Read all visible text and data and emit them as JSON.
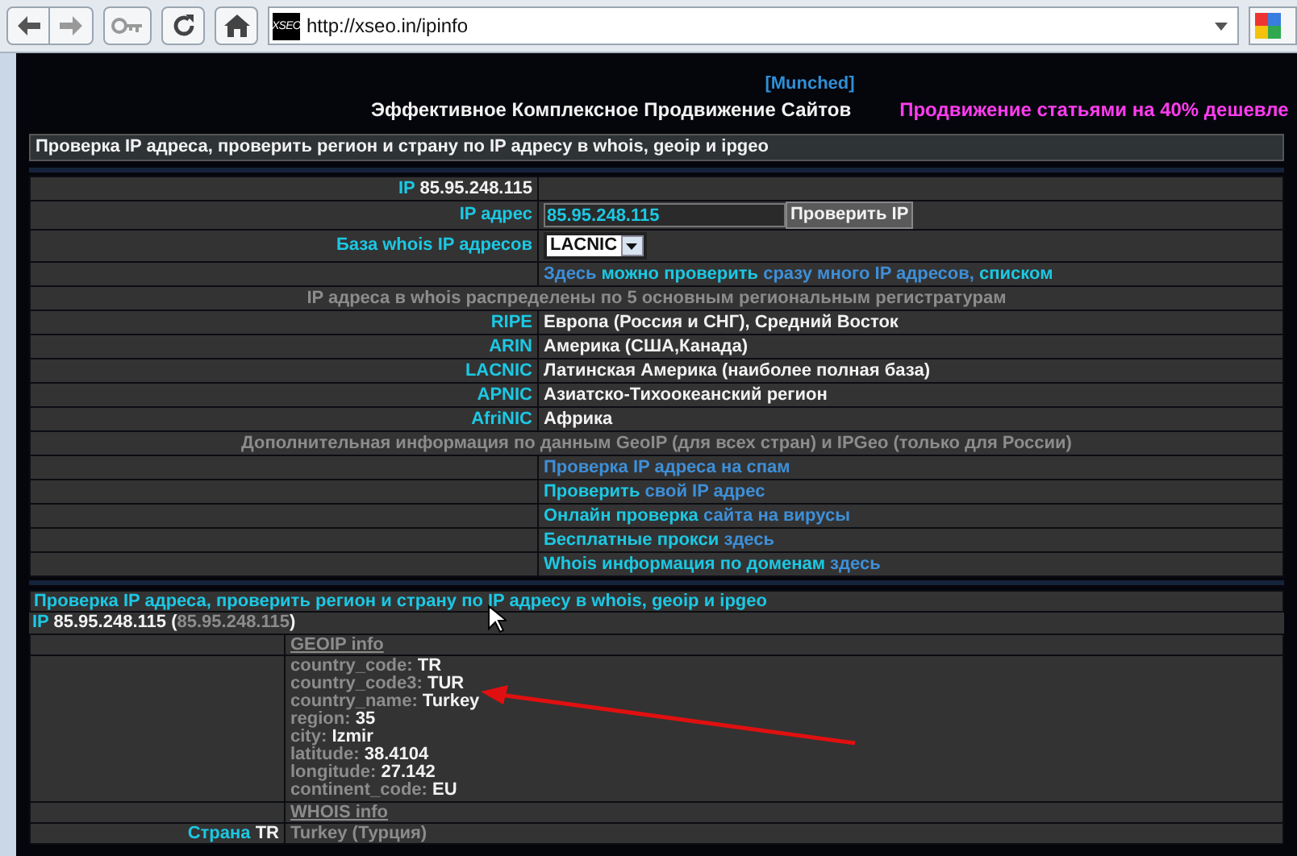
{
  "browser": {
    "url": "http://xseo.in/ipinfo",
    "site_badge": "XSEO"
  },
  "munched": "[Munched]",
  "headline": "Эффективное Комплексное Продвижение Сайтов",
  "promo": "Продвижение статьями на 40% дешевле",
  "section1": {
    "title": "Проверка IP адреса, проверить регион и страну по IP адресу в whois, geoip и ipgeo",
    "rows": [
      {
        "kind": "pair",
        "label": [
          {
            "text": "IP",
            "kind": "accent"
          },
          {
            "text": "85.95.248.115",
            "kind": "plain"
          }
        ],
        "value": []
      },
      {
        "kind": "input",
        "label": [
          {
            "text": "IP адрес",
            "kind": "accent"
          }
        ],
        "value_text": "85.95.248.115",
        "button": "Проверить IP"
      },
      {
        "kind": "select",
        "label": [
          {
            "text": "База whois IP адресов",
            "kind": "accent"
          }
        ],
        "selected_option": "LACNIC"
      },
      {
        "kind": "pair",
        "label": [],
        "value": [
          {
            "text": "Здесь",
            "kind": "link"
          },
          {
            "text": "можно проверить",
            "kind": "accent"
          },
          {
            "text": "сразу много IP адресов,",
            "kind": "link"
          },
          {
            "text": "списком",
            "kind": "accent"
          }
        ]
      },
      {
        "kind": "note",
        "text": "IP адреса в whois распределены по 5 основным региональным регистратурам"
      },
      {
        "kind": "pair",
        "label": [
          {
            "text": "RIPE",
            "kind": "accent"
          }
        ],
        "value": [
          {
            "text": "Европа (Россия и СНГ), Средний Восток",
            "kind": "plain"
          }
        ]
      },
      {
        "kind": "pair",
        "label": [
          {
            "text": "ARIN",
            "kind": "accent"
          }
        ],
        "value": [
          {
            "text": "Америка (США,Канада)",
            "kind": "plain"
          }
        ]
      },
      {
        "kind": "pair",
        "label": [
          {
            "text": "LACNIC",
            "kind": "accent"
          }
        ],
        "value": [
          {
            "text": "Латинская Америка (наиболее полная база)",
            "kind": "plain"
          }
        ]
      },
      {
        "kind": "pair",
        "label": [
          {
            "text": "APNIC",
            "kind": "accent"
          }
        ],
        "value": [
          {
            "text": "Азиатско-Тихоокеанский регион",
            "kind": "plain"
          }
        ]
      },
      {
        "kind": "pair",
        "label": [
          {
            "text": "AfriNIC",
            "kind": "accent"
          }
        ],
        "value": [
          {
            "text": "Африка",
            "kind": "plain"
          }
        ]
      },
      {
        "kind": "note",
        "text": "Дополнительная информация по данным GeoIP (для всех стран) и IPGeo (только для России)"
      },
      {
        "kind": "pair",
        "label": [],
        "value": [
          {
            "text": "Проверка IP адреса на спам",
            "kind": "link"
          }
        ]
      },
      {
        "kind": "pair",
        "label": [],
        "value": [
          {
            "text": "Проверить",
            "kind": "accent"
          },
          {
            "text": "свой IP адрес",
            "kind": "link"
          }
        ]
      },
      {
        "kind": "pair",
        "label": [],
        "value": [
          {
            "text": "Онлайн проверка",
            "kind": "accent"
          },
          {
            "text": "сайта на вирусы",
            "kind": "link"
          }
        ]
      },
      {
        "kind": "pair",
        "label": [],
        "value": [
          {
            "text": "Бесплатные прокси",
            "kind": "accent"
          },
          {
            "text": "здесь",
            "kind": "link"
          }
        ]
      },
      {
        "kind": "pair",
        "label": [],
        "value": [
          {
            "text": "Whois информация по доменам",
            "kind": "accent"
          },
          {
            "text": "здесь",
            "kind": "link"
          }
        ]
      }
    ]
  },
  "section2": {
    "title": "Проверка IP адреса, проверить регион и страну по IP адресу в whois, geoip и ipgeo",
    "ip_line": [
      {
        "text": "IP",
        "kind": "accent",
        "attached": false
      },
      {
        "text": "85.95.248.115",
        "kind": "plain",
        "attached": false
      },
      {
        "text": "(",
        "kind": "plain",
        "attached": false
      },
      {
        "text": "85.95.248.115",
        "kind": "muted",
        "attached": true
      },
      {
        "text": ")",
        "kind": "plain",
        "attached": true
      }
    ],
    "geoip_heading": "GEOIP info",
    "geoip": [
      {
        "key": "country_code:",
        "value": "TR"
      },
      {
        "key": "country_code3:",
        "value": "TUR"
      },
      {
        "key": "country_name:",
        "value": "Turkey"
      },
      {
        "key": "region:",
        "value": "35"
      },
      {
        "key": "city:",
        "value": "Izmir"
      },
      {
        "key": "latitude:",
        "value": "38.4104"
      },
      {
        "key": "longitude:",
        "value": "27.142"
      },
      {
        "key": "continent_code:",
        "value": "EU"
      }
    ],
    "whois_heading": "WHOIS info",
    "country_row": {
      "label": [
        {
          "text": "Страна",
          "kind": "accent"
        },
        {
          "text": "TR",
          "kind": "plain"
        }
      ],
      "value": "Turkey (Турция)"
    }
  }
}
